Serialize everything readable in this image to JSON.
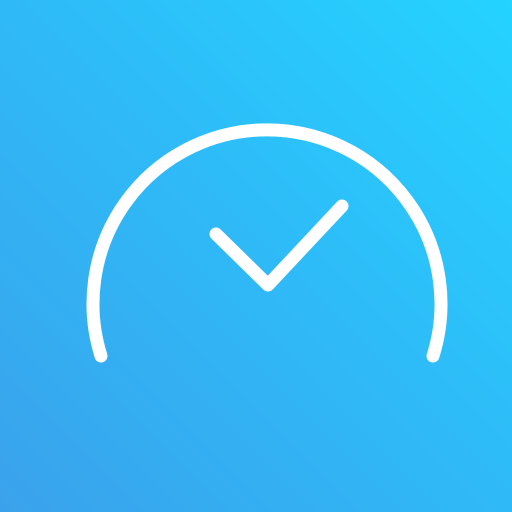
{
  "icon": {
    "name": "gauge-check-app-icon",
    "colors": {
      "gradient_top_right": "#24d3ff",
      "gradient_bottom_left": "#3aa2ec",
      "stroke": "#ffffff"
    },
    "glyphs": [
      "gauge-arc",
      "checkmark"
    ]
  }
}
